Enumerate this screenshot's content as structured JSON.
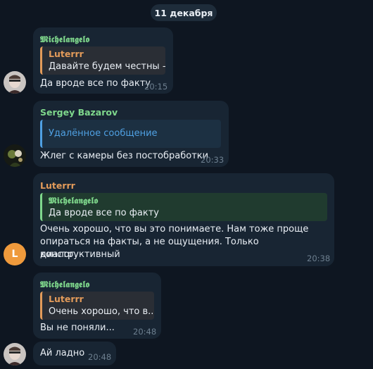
{
  "date_label": "11 декабря",
  "colors": {
    "background": "#0e1621",
    "bubble": "#182533",
    "author_green": "#7fd88c",
    "author_orange": "#e39b5a",
    "reply_bg_orange": "#2a2e35",
    "reply_bg_blue": "#1c3042",
    "reply_bg_green": "#203b2f",
    "deleted_blue": "#4fa0e2",
    "time": "#6d7f8f"
  },
  "messages": [
    {
      "author": "𝕸𝖎𝖈𝖍𝖊𝖑𝖆𝖓𝖌𝖊𝖑𝖔",
      "reply_author": "Luterrr",
      "reply_text": "Давайте будем честны - ...",
      "text": "Да вроде все по факту",
      "time": "20:15"
    },
    {
      "author": "Sergey Bazarov",
      "reply_text": "Удалённое сообщение",
      "text": "Жлег с камеры без постобработки",
      "time": "20:33"
    },
    {
      "author": "Luterrr",
      "reply_author": "𝕸𝖎𝖈𝖍𝖊𝖑𝖆𝖓𝖌𝖊𝖑𝖔",
      "reply_text": "Да вроде все по факту",
      "text_lines": [
        "Очень хорошо, что вы это понимаете. Нам тоже проще",
        "опираться на факты, а не ощущения. Только конструктивный",
        "диалог."
      ],
      "time": "20:38",
      "avatar_letter": "L"
    },
    {
      "author": "𝕸𝖎𝖈𝖍𝖊𝖑𝖆𝖓𝖌𝖊𝖑𝖔",
      "reply_author": "Luterrr",
      "reply_text": "Очень хорошо, что в...",
      "text": "Вы не поняли...",
      "time": "20:48"
    },
    {
      "text": "Ай ладно",
      "time": "20:48"
    }
  ]
}
